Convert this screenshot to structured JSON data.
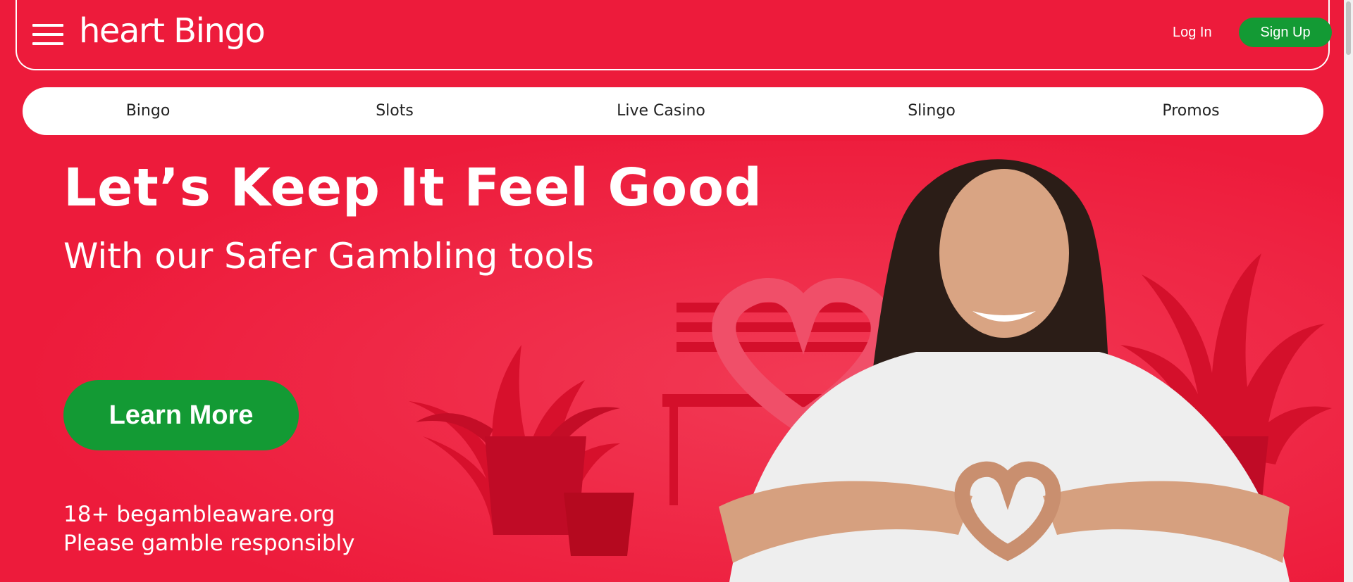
{
  "header": {
    "logo_text": "heart Bingo",
    "login_label": "Log In",
    "signup_label": "Sign Up"
  },
  "nav": {
    "items": [
      {
        "label": "Bingo"
      },
      {
        "label": "Slots"
      },
      {
        "label": "Live Casino"
      },
      {
        "label": "Slingo"
      },
      {
        "label": "Promos"
      }
    ]
  },
  "hero": {
    "headline": "Let’s Keep It Feel Good",
    "subheadline": "With our Safer Gambling tools",
    "cta_label": "Learn More",
    "disclaimer_line1": "18+ begambleaware.org",
    "disclaimer_line2": "Please gamble responsibly"
  },
  "colors": {
    "brand_red": "#ed1b3b",
    "cta_green": "#139a34",
    "nav_background": "#ffffff"
  },
  "icons": {
    "menu": "hamburger-menu-icon"
  }
}
